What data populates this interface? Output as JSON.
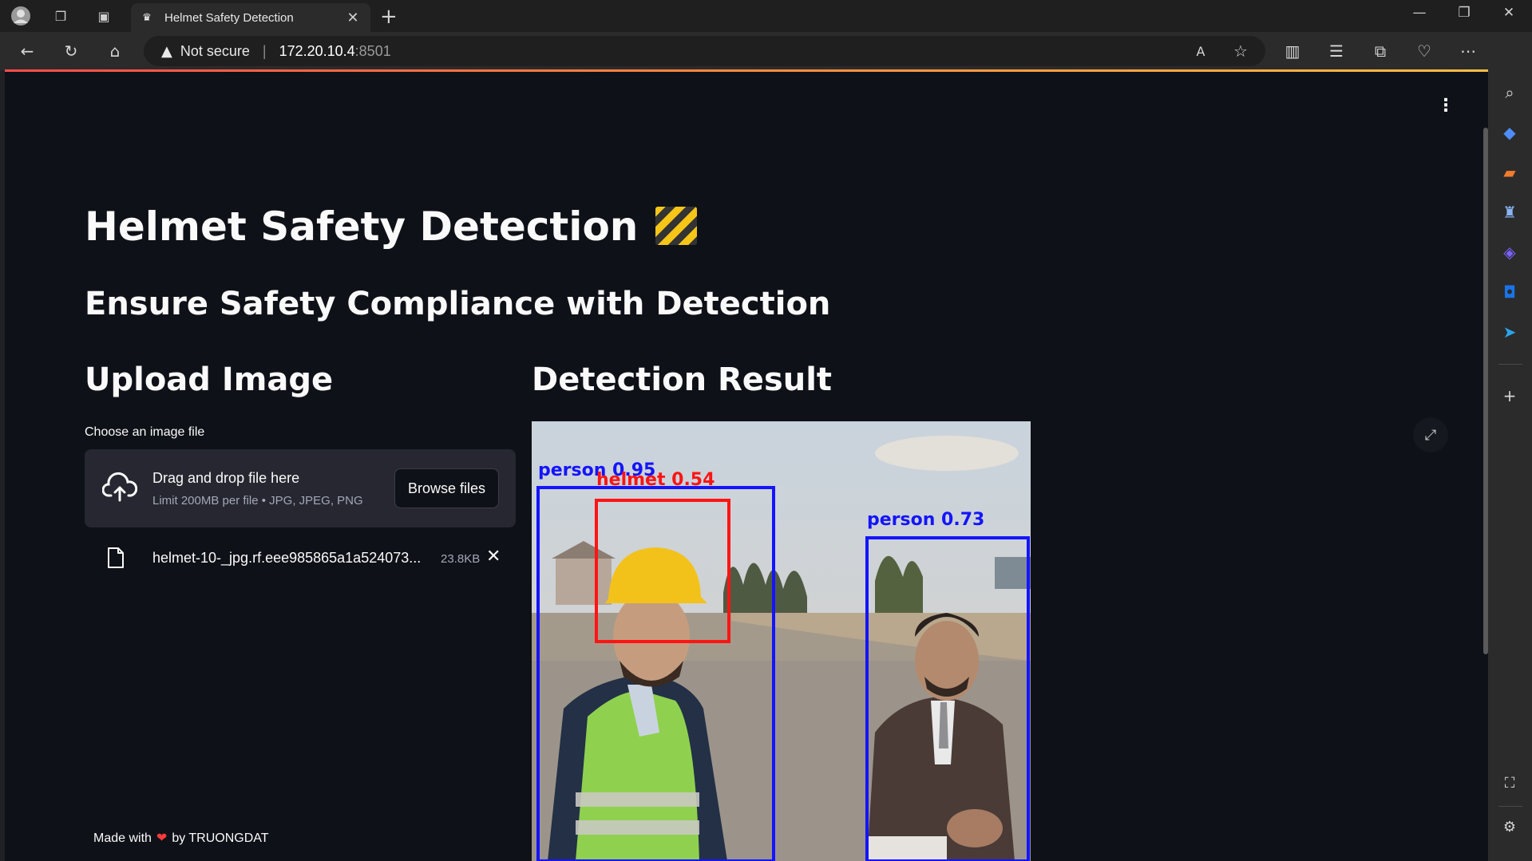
{
  "browser": {
    "tab_title": "Helmet Safety Detection",
    "security_label": "Not secure",
    "url_host": "172.20.10.4",
    "url_port": ":8501",
    "icons": [
      "profile-icon",
      "workspaces-icon",
      "tab-actions-icon",
      "back-icon",
      "refresh-icon",
      "home-icon",
      "read-aloud-icon",
      "favorite-icon",
      "split-screen-icon",
      "favorites-icon",
      "collections-icon",
      "health-icon",
      "more-icon",
      "copilot-icon"
    ]
  },
  "app": {
    "title": "Helmet Safety Detection",
    "subtitle": "Ensure Safety Compliance with Detection",
    "upload_heading": "Upload Image",
    "result_heading": "Detection Result",
    "uploader": {
      "label": "Choose an image file",
      "drop_title": "Drag and drop file here",
      "drop_subtitle": "Limit 200MB per file • JPG, JPEG, PNG",
      "browse_label": "Browse files"
    },
    "uploaded_file": {
      "name": "helmet-10-_jpg.rf.eee985865a1a524073...",
      "size": "23.8KB"
    },
    "detections": [
      {
        "label": "person 0.95",
        "class": "person",
        "confidence": 0.95,
        "color": "#1414ff"
      },
      {
        "label": "helmet 0.54",
        "class": "helmet",
        "confidence": 0.54,
        "color": "#ff1414"
      },
      {
        "label": "person 0.73",
        "class": "person",
        "confidence": 0.73,
        "color": "#1414ff"
      }
    ],
    "footer": {
      "prefix": "Made with",
      "heart": "❤",
      "suffix": "by TRUONGDAT"
    },
    "accent_color": "#ff4b4b",
    "background_color": "#0e1117"
  }
}
